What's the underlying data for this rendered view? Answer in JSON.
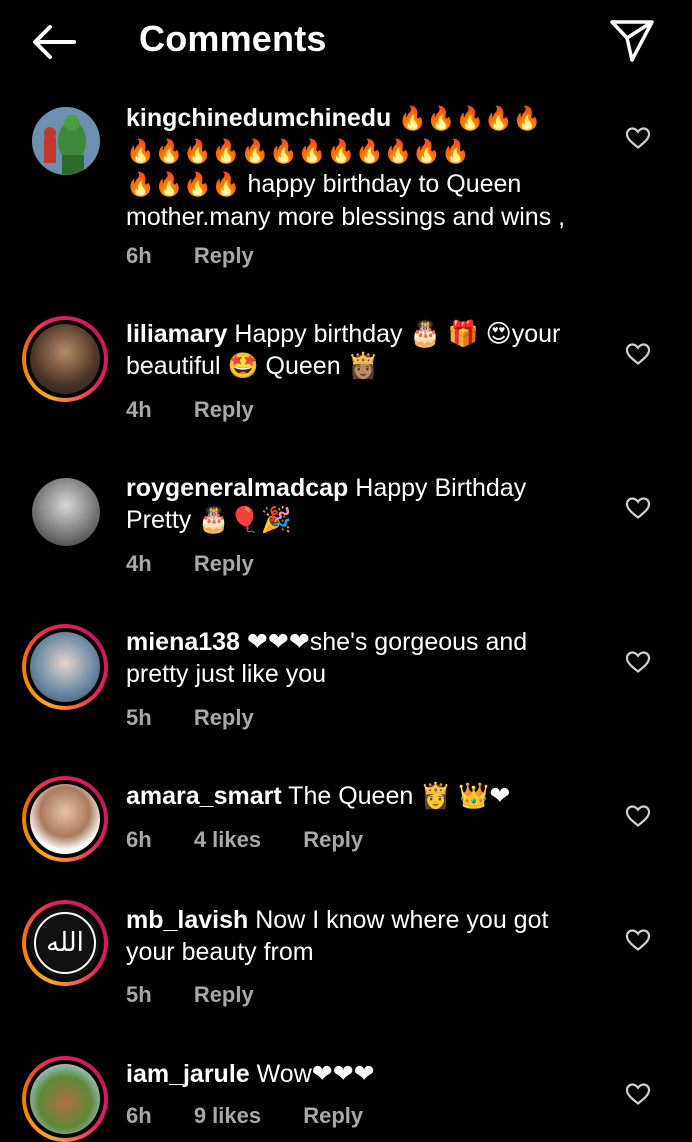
{
  "header": {
    "title": "Comments"
  },
  "comments": [
    {
      "username": "kingchinedumchinedu",
      "emoji_line1": "🔥🔥🔥🔥🔥",
      "emoji_line2": "🔥🔥🔥🔥🔥🔥🔥🔥🔥🔥🔥🔥",
      "emoji_line3": "🔥🔥🔥🔥",
      "text": "happy birthday to Queen mother.many more blessings and wins ,",
      "time": "6h",
      "reply": "Reply"
    },
    {
      "username": "liliamary",
      "text": "Happy birthday 🎂 🎁 😍your beautiful 🤩 Queen 👸🏽",
      "time": "4h",
      "reply": "Reply"
    },
    {
      "username": "roygeneralmadcap",
      "text": "Happy Birthday Pretty 🎂🎈🎉",
      "time": "4h",
      "reply": "Reply"
    },
    {
      "username": "miena138",
      "text": "❤❤❤she's gorgeous and pretty just like you",
      "time": "5h",
      "reply": "Reply"
    },
    {
      "username": "amara_smart",
      "text": "The Queen 👸 👑❤",
      "time": "6h",
      "likes": "4 likes",
      "reply": "Reply"
    },
    {
      "username": "mb_lavish",
      "text": "Now I know where you got your beauty from",
      "time": "5h",
      "reply": "Reply"
    },
    {
      "username": "iam_jarule",
      "text": "Wow❤❤❤",
      "time": "6h",
      "likes": "9 likes",
      "reply": "Reply"
    }
  ],
  "avatar_text": {
    "mb_lavish": "الله"
  },
  "colors": {
    "background": "#000000",
    "text": "#ffffff",
    "meta": "#a8a8a8",
    "ring_start": "#f9a825",
    "ring_end": "#e91e63"
  },
  "icons": {
    "back": "arrow-left-icon",
    "share": "paper-plane-icon",
    "like": "heart-outline-icon"
  }
}
